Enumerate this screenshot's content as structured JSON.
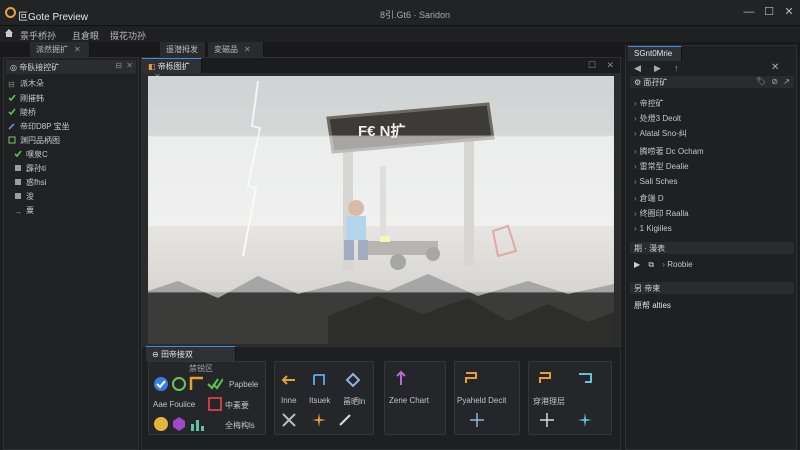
{
  "titlebar": {
    "app_title": "叵Gote Preview",
    "center_title": "8引.Gt6 · Saridon",
    "window_controls": {
      "minimize": "—",
      "maximize": "☐",
      "close": "✕"
    }
  },
  "menubar": {
    "items": [
      "景乎桥孙",
      "且倉眼",
      "掇花功孙"
    ]
  },
  "left_panel": {
    "tab_label": "派然掘扩",
    "header_label": "帝臥接控矿",
    "rows": [
      {
        "label": "派木朵",
        "icon": "none"
      },
      {
        "label": "刚摧韩",
        "icon": "check-icon"
      },
      {
        "label": "陵桥",
        "icon": "check-icon"
      },
      {
        "label": "帝印D8P 宝坐",
        "icon": "pen-icon"
      },
      {
        "label": "渊円品柄图",
        "icon": "grid-icon"
      },
      {
        "label": "嘿泉C",
        "icon": "check-icon"
      },
      {
        "label": "霹孙ti",
        "icon": "square-icon"
      },
      {
        "label": "惑fhsi",
        "icon": "square-icon"
      },
      {
        "label": "浚",
        "icon": "square-icon"
      },
      {
        "label": "粟",
        "icon": "arrow-icon"
      }
    ]
  },
  "doc_tabs": [
    {
      "label": "遥潜拇发",
      "active": false
    },
    {
      "label": "変磁品",
      "active": false
    }
  ],
  "viewport": {
    "tab_label": "帝栎图扩",
    "sign_text": "F€ N扩",
    "accent_color": "#e8f15a"
  },
  "tool_panel": {
    "tab_label": "田帝接双",
    "group1_header": "禁锐区",
    "group1_labels": [
      "Papbele",
      "Aae Fouiice",
      "中素要",
      "全梅构ls"
    ],
    "group2_labels": [
      "Inne",
      "Itsuek",
      "畐晒ln"
    ],
    "group3_label": "Zene Chart",
    "group4_label": "Pyaheld Decit",
    "group5_label": "穿港理层"
  },
  "right_panel": {
    "tab_label": "SGnt0Mrie",
    "header_label": "面孖矿",
    "tree_items": [
      "帝控矿",
      "处燈3 Deolt",
      "Alatal Sno-纠",
      "腾唠著 Dc Ocham",
      "雷常型 Dealie",
      "Sali Sches",
      "倉端 D",
      "终圈印 Raalla",
      "1 Kigiiles"
    ],
    "section2_header": "期 ·  漫表",
    "section2_item": "Roobie",
    "section3_header": "另 帝柬",
    "section3_item": "原帮 alties"
  }
}
